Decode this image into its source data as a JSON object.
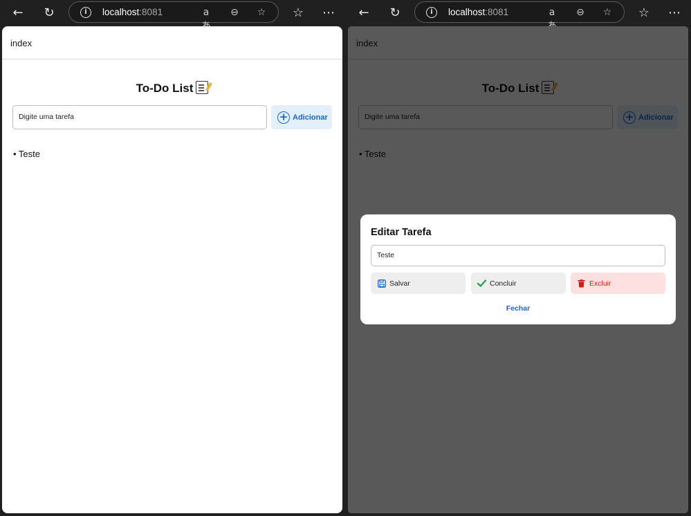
{
  "browser": {
    "url_host": "localhost",
    "url_port": ":8081",
    "icons": [
      "back-icon",
      "refresh-icon",
      "info-icon",
      "translate-icon",
      "zoom-out-icon",
      "favorite-star-icon",
      "favorites-list-icon",
      "more-icon"
    ]
  },
  "page": {
    "tab_title": "index",
    "app_title": "To-Do List",
    "input_value": "Digite uma tarefa",
    "add_button_label": "Adicionar",
    "tasks": [
      "• Teste"
    ]
  },
  "modal": {
    "title": "Editar Tarefa",
    "input_value": "Teste",
    "save_label": "Salvar",
    "done_label": "Concluir",
    "delete_label": "Excluir",
    "close_label": "Fechar"
  },
  "colors": {
    "accent": "#1b66c9",
    "danger": "#d11b1b",
    "success": "#2aa14a"
  }
}
